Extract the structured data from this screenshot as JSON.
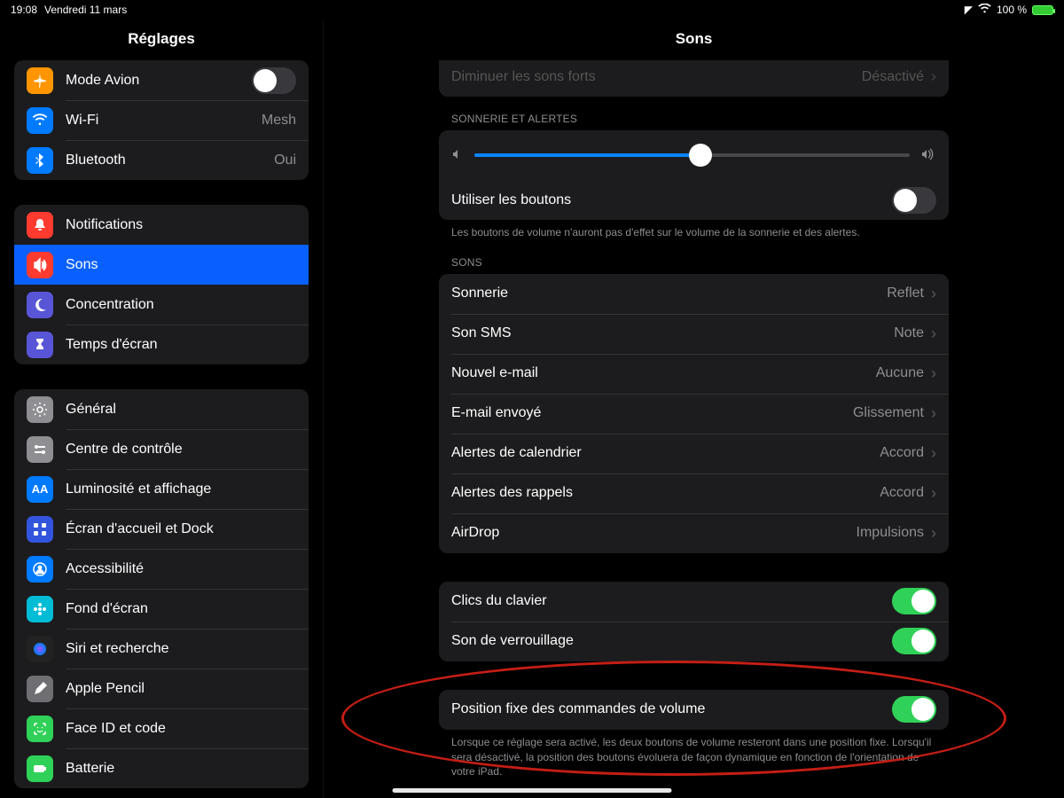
{
  "statusbar": {
    "time": "19:08",
    "date": "Vendredi 11 mars",
    "battery": "100 %"
  },
  "sidebar": {
    "title": "Réglages",
    "group1": [
      {
        "icon": "airplane",
        "color": "#ff9500",
        "label": "Mode Avion",
        "toggle": false
      },
      {
        "icon": "wifi",
        "color": "#007aff",
        "label": "Wi-Fi",
        "value": "Mesh"
      },
      {
        "icon": "bluetooth",
        "color": "#007aff",
        "label": "Bluetooth",
        "value": "Oui"
      }
    ],
    "group2": [
      {
        "icon": "bell",
        "color": "#ff3b30",
        "label": "Notifications"
      },
      {
        "icon": "speaker",
        "color": "#ff3b30",
        "label": "Sons",
        "selected": true
      },
      {
        "icon": "moon",
        "color": "#5856d6",
        "label": "Concentration"
      },
      {
        "icon": "hourglass",
        "color": "#5856d6",
        "label": "Temps d'écran"
      }
    ],
    "group3": [
      {
        "icon": "gear",
        "color": "#8e8e93",
        "label": "Général"
      },
      {
        "icon": "switches",
        "color": "#8e8e93",
        "label": "Centre de contrôle"
      },
      {
        "icon": "aa",
        "color": "#007aff",
        "label": "Luminosité et affichage"
      },
      {
        "icon": "grid",
        "color": "#3355dd",
        "label": "Écran d'accueil et Dock"
      },
      {
        "icon": "person",
        "color": "#007aff",
        "label": "Accessibilité"
      },
      {
        "icon": "flower",
        "color": "#00bcd4",
        "label": "Fond d'écran"
      },
      {
        "icon": "siri",
        "color": "#222",
        "label": "Siri et recherche"
      },
      {
        "icon": "pencil",
        "color": "#6e6e73",
        "label": "Apple Pencil"
      },
      {
        "icon": "faceid",
        "color": "#30d158",
        "label": "Face ID et code"
      },
      {
        "icon": "battery",
        "color": "#30d158",
        "label": "Batterie"
      }
    ]
  },
  "content": {
    "title": "Sons",
    "cutoff": {
      "label": "Diminuer les sons forts",
      "value": "Désactivé"
    },
    "ringer_header": "SONNERIE ET ALERTES",
    "slider_percent": 52,
    "use_buttons_label": "Utiliser les boutons",
    "use_buttons_on": false,
    "use_buttons_foot": "Les boutons de volume n'auront pas d'effet sur le volume de la sonnerie et des alertes.",
    "sounds_header": "SONS",
    "sounds": [
      {
        "label": "Sonnerie",
        "value": "Reflet"
      },
      {
        "label": "Son SMS",
        "value": "Note"
      },
      {
        "label": "Nouvel e-mail",
        "value": "Aucune"
      },
      {
        "label": "E-mail envoyé",
        "value": "Glissement"
      },
      {
        "label": "Alertes de calendrier",
        "value": "Accord"
      },
      {
        "label": "Alertes des rappels",
        "value": "Accord"
      },
      {
        "label": "AirDrop",
        "value": "Impulsions"
      }
    ],
    "keys_clicks_label": "Clics du clavier",
    "keys_clicks_on": true,
    "lock_sound_label": "Son de verrouillage",
    "lock_sound_on": true,
    "fixed_pos_label": "Position fixe des commandes de volume",
    "fixed_pos_on": true,
    "fixed_pos_foot": "Lorsque ce réglage sera activé, les deux boutons de volume resteront dans une position fixe. Lorsqu'il sera désactivé, la position des boutons évoluera de façon dynamique en fonction de l'orientation de votre iPad."
  }
}
